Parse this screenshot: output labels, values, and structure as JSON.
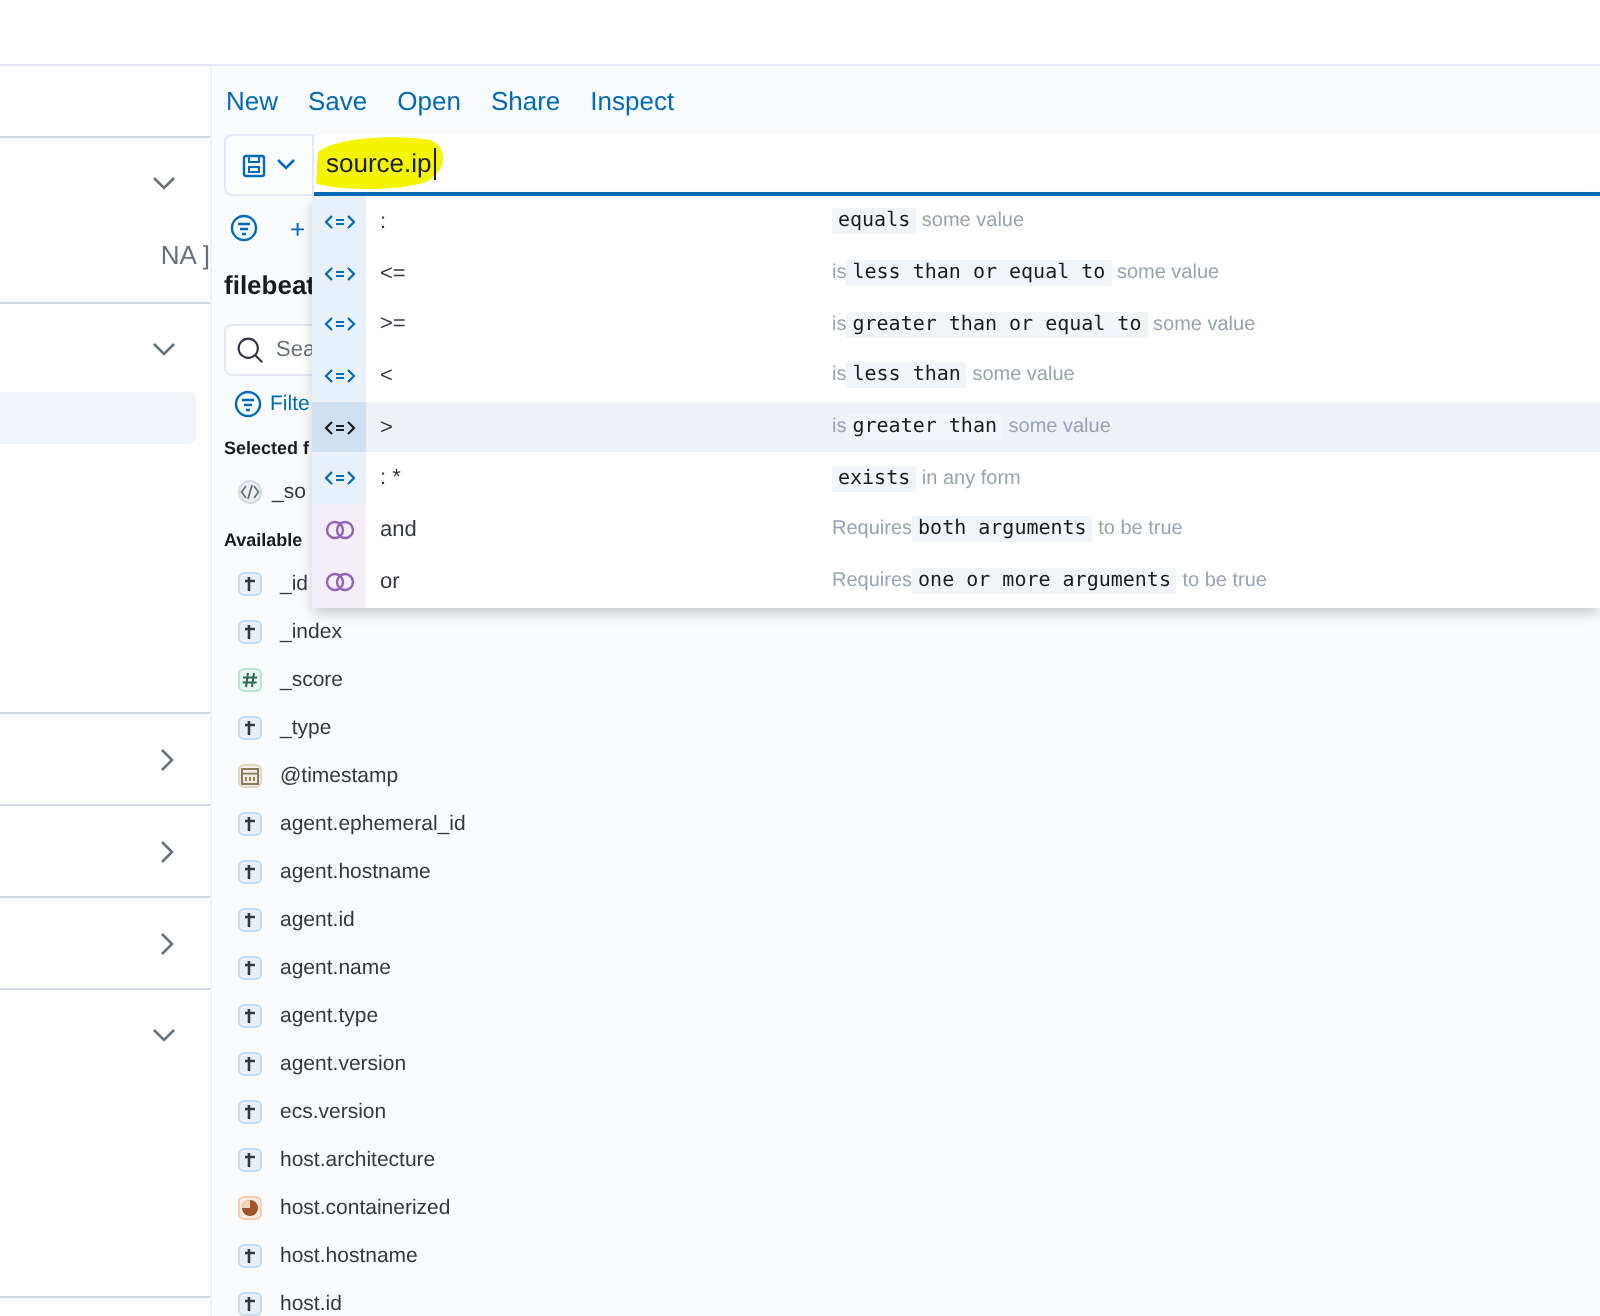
{
  "nav_sections": [
    {
      "expanded": true,
      "text": "NA ]"
    },
    {
      "expanded": true,
      "highlight": true
    },
    {
      "expanded": false
    },
    {
      "expanded": false
    },
    {
      "expanded": false
    },
    {
      "expanded": true
    }
  ],
  "menu": [
    "New",
    "Save",
    "Open",
    "Share",
    "Inspect"
  ],
  "query": {
    "value": "source.ip"
  },
  "add_filter": "+",
  "sidebar": {
    "index_pattern": "filebeat",
    "search_placeholder": "Sea",
    "filter_label": "Filte",
    "selected_heading": "Selected f",
    "selected_fields": [
      {
        "kind": "source",
        "name": "_so"
      }
    ],
    "available_heading": "Available",
    "available_fields": [
      {
        "kind": "string",
        "name": "_id"
      },
      {
        "kind": "string",
        "name": "_index"
      },
      {
        "kind": "number",
        "name": "_score"
      },
      {
        "kind": "string",
        "name": "_type"
      },
      {
        "kind": "date",
        "name": "@timestamp"
      },
      {
        "kind": "string",
        "name": "agent.ephemeral_id"
      },
      {
        "kind": "string",
        "name": "agent.hostname"
      },
      {
        "kind": "string",
        "name": "agent.id"
      },
      {
        "kind": "string",
        "name": "agent.name"
      },
      {
        "kind": "string",
        "name": "agent.type"
      },
      {
        "kind": "string",
        "name": "agent.version"
      },
      {
        "kind": "string",
        "name": "ecs.version"
      },
      {
        "kind": "string",
        "name": "host.architecture"
      },
      {
        "kind": "boolean",
        "name": "host.containerized"
      },
      {
        "kind": "string",
        "name": "host.hostname"
      },
      {
        "kind": "string",
        "name": "host.id"
      }
    ]
  },
  "suggestions": [
    {
      "kind": "operator",
      "label": ":",
      "code": "equals",
      "suffix": "some value",
      "selected": false
    },
    {
      "kind": "operator",
      "label": "<=",
      "prefix": "is",
      "code": "less than or equal to",
      "suffix": "some value",
      "selected": false
    },
    {
      "kind": "operator",
      "label": ">=",
      "prefix": "is",
      "code": "greater than or equal to",
      "suffix": "some value",
      "selected": false
    },
    {
      "kind": "operator",
      "label": "<",
      "prefix": "is",
      "code": "less than",
      "suffix": "some value",
      "selected": false
    },
    {
      "kind": "operator",
      "label": ">",
      "prefix": "is",
      "code": "greater than",
      "suffix": "some value",
      "selected": true
    },
    {
      "kind": "operator",
      "label": ": *",
      "code": "exists",
      "suffix": "in any form",
      "selected": false
    },
    {
      "kind": "conjunction",
      "label": "and",
      "prefix": "Requires",
      "code": "both arguments",
      "suffix": "to be true",
      "selected": false
    },
    {
      "kind": "conjunction",
      "label": "or",
      "prefix": "Requires",
      "code": "one or more arguments",
      "suffix": "to be true",
      "selected": false
    }
  ]
}
